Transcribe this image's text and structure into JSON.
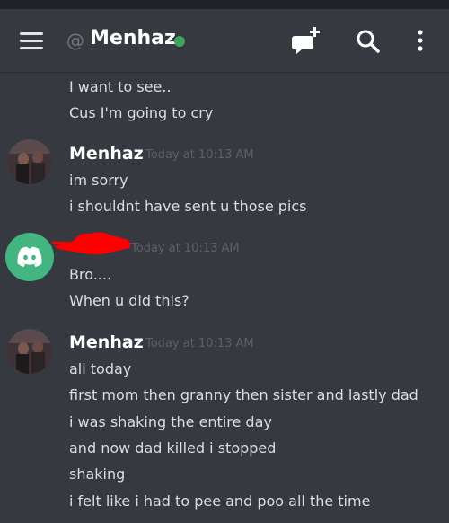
{
  "header": {
    "at_symbol": "@",
    "title": "Menhaz",
    "status_color": "#3ba55c",
    "icons": [
      "menu-icon",
      "add-friend-icon",
      "search-icon",
      "more-options-icon"
    ]
  },
  "messages": {
    "m0_line1": "I want to see..",
    "m0_line2": "Cus I'm going to cry",
    "m1_author": "Menhaz",
    "m1_time": "Today at 10:13 AM",
    "m1_line1": "im sorry",
    "m1_line2": "i shouldnt have sent u those pics",
    "m2_time": "Today at 10:13 AM",
    "m2_line1": "Bro....",
    "m2_line2": "When u did this?",
    "m3_author": "Menhaz",
    "m3_time": "Today at 10:13 AM",
    "m3_line1": "all today",
    "m3_line2": "first mom then granny then sister and lastly dad",
    "m3_line3": "i was shaking the entire day",
    "m3_line4": "and now dad killed i stopped",
    "m3_line5": "shaking",
    "m3_line6": "i felt like i had to pee and poo all the time"
  },
  "colors": {
    "background": "#36393f",
    "text": "#dcddde",
    "timestamp": "#5d6066",
    "discord_avatar": "#43b581",
    "redaction": "#ff0000"
  }
}
